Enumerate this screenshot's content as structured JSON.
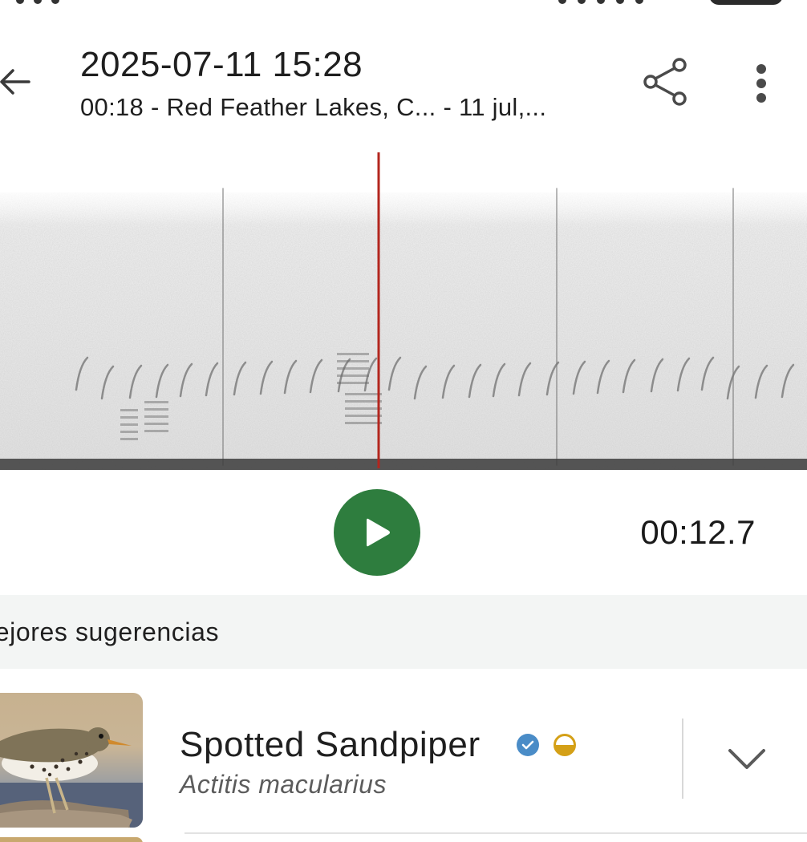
{
  "header": {
    "title": "2025-07-11 15:28",
    "subtitle": "00:18 - Red Feather Lakes, C... - 11 jul,...",
    "back_icon": "arrow-left-icon",
    "share_icon": "share-icon",
    "more_icon": "more-vertical-icon"
  },
  "spectrogram": {
    "playhead_color": "#b3261e",
    "playhead_position": 0.469
  },
  "player": {
    "play_icon": "play-icon",
    "play_color": "#2e7d3e",
    "time": "00:12.7"
  },
  "suggestions": {
    "section_title": "lejores sugerencias",
    "items": [
      {
        "common_name": "Spotted Sandpiper",
        "scientific_name": "Actitis macularius",
        "verified_icon": "verified-check-icon",
        "verified_color": "#4a8cc7",
        "rarity_icon": "half-circle-rarity-icon",
        "rarity_color": "#d4a017",
        "expand_icon": "chevron-down-icon"
      }
    ]
  }
}
